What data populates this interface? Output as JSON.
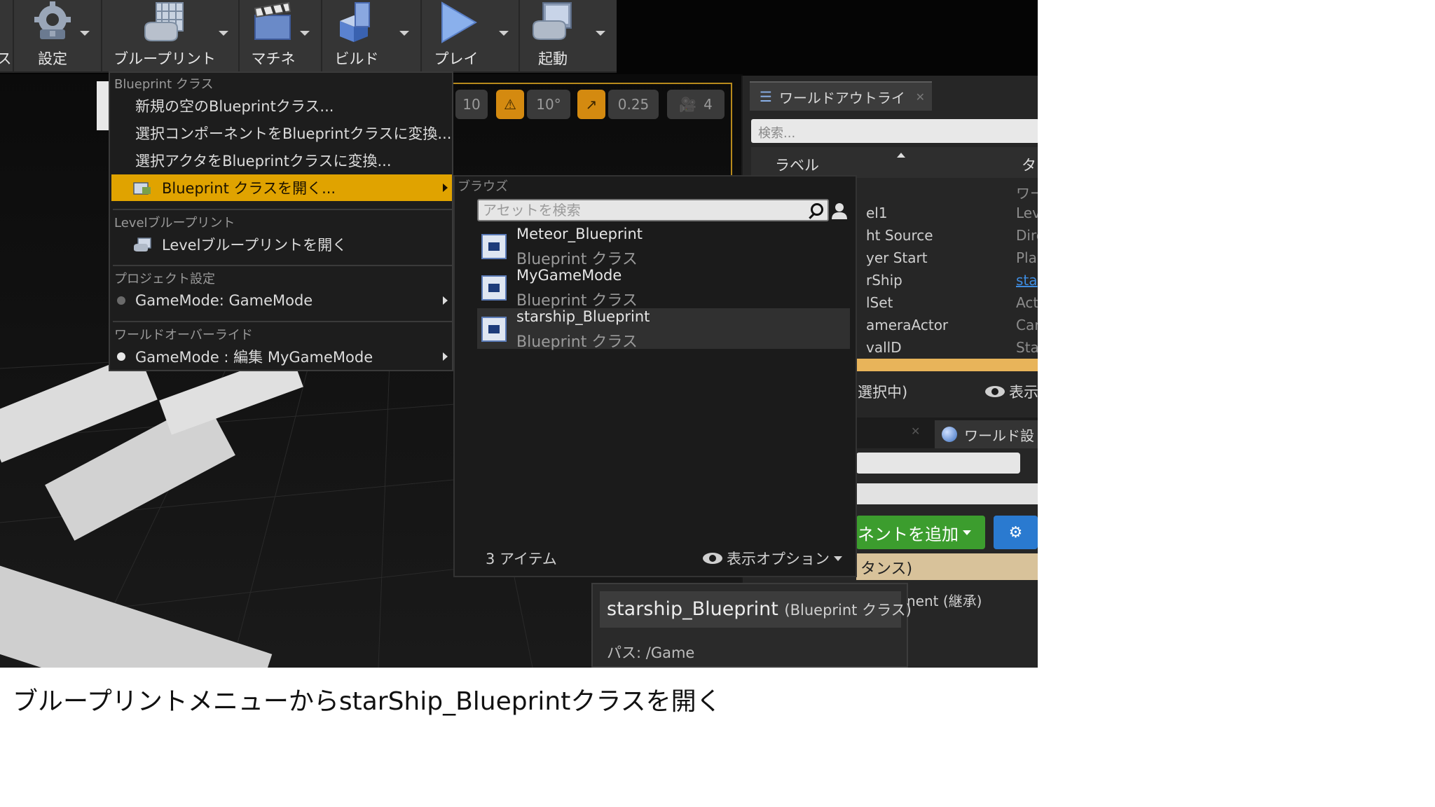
{
  "toolbar": {
    "partial_label": "ス",
    "buttons": [
      {
        "label": "設定"
      },
      {
        "label": "ブループリント"
      },
      {
        "label": "マチネ"
      },
      {
        "label": "ビルド"
      },
      {
        "label": "プレイ"
      },
      {
        "label": "起動"
      }
    ]
  },
  "viewport": {
    "chips": [
      "10",
      "10°",
      "0.25",
      "4"
    ]
  },
  "menu": {
    "section_blueprint_class": "Blueprint クラス",
    "new_empty": "新規の空のBlueprintクラス...",
    "convert_component": "選択コンポーネントをBlueprintクラスに変換...",
    "convert_actor": "選択アクタをBlueprintクラスに変換...",
    "open_class": "Blueprint クラスを開く...",
    "section_level": "Levelブループリント",
    "open_level": "Levelブループリントを開く",
    "section_project": "プロジェクト設定",
    "project_gamemode": "GameMode: GameMode",
    "section_world": "ワールドオーバーライド",
    "world_gamemode": "GameMode : 編集 MyGameMode"
  },
  "browser": {
    "title": "ブラウズ",
    "search_placeholder": "アセットを検索",
    "assets": [
      {
        "name": "Meteor_Blueprint",
        "type": "Blueprint クラス"
      },
      {
        "name": "MyGameMode",
        "type": "Blueprint クラス"
      },
      {
        "name": "starship_Blueprint",
        "type": "Blueprint クラス"
      }
    ],
    "count": "3 アイテム",
    "view_options": "表示オプション"
  },
  "outliner": {
    "tab": "ワールドアウトライ",
    "search_placeholder": "検索...",
    "col_label": "ラベル",
    "col_type": "タ",
    "rows": [
      {
        "label": "",
        "type": "ワー"
      },
      {
        "label": "el1",
        "type": "Lev"
      },
      {
        "label": "ht Source",
        "type": "Dire"
      },
      {
        "label": "yer Start",
        "type": "Pla"
      },
      {
        "label": "rShip",
        "type": "sta"
      },
      {
        "label": "lSet",
        "type": "Act"
      },
      {
        "label": "ameraActor",
        "type": "Car"
      },
      {
        "label": "vallD",
        "type": "Sta"
      }
    ],
    "status_count": "選択中)",
    "status_view": "表示"
  },
  "details": {
    "tab_world": "ワールド設",
    "add_component": "ネントを追加",
    "instance": "タンス)",
    "component": "nent (継承)"
  },
  "tooltip": {
    "name": "starship_Blueprint",
    "class": "(Blueprint クラス)",
    "path": "パス: /Game"
  },
  "caption": "ブループリントメニューからstarShip_Blueprintクラスを開く",
  "colors": {
    "highlight": "#e0a300",
    "add_button": "#3c9d2e",
    "link": "#3e8ce0"
  }
}
